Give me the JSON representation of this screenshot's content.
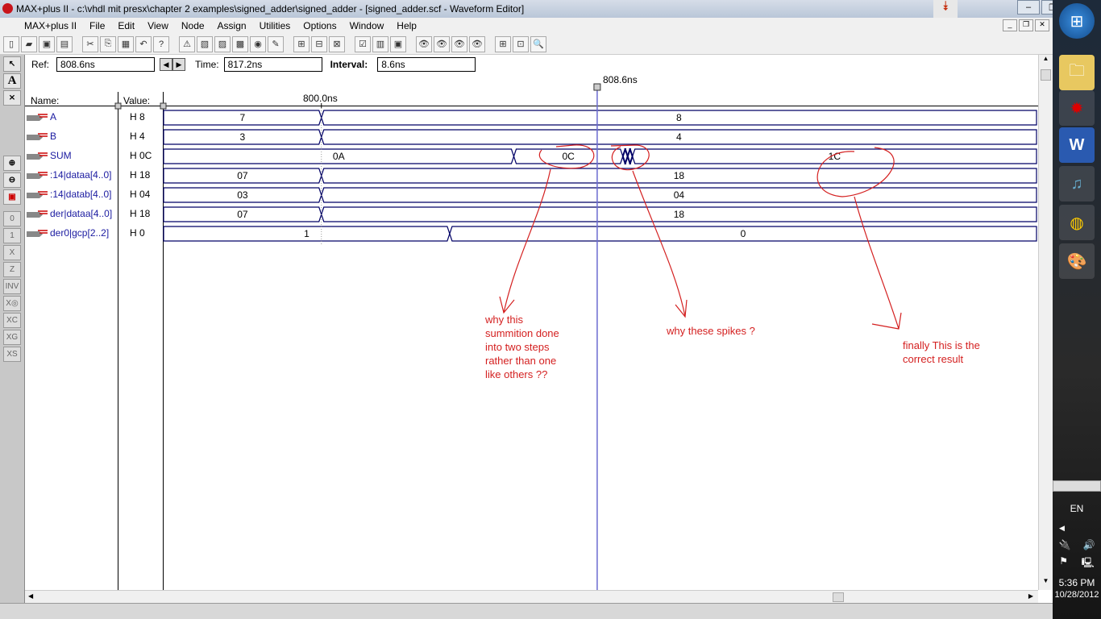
{
  "window": {
    "title": "MAX+plus II - c:\\vhdl mit presx\\chapter 2 examples\\signed_adder\\signed_adder - [signed_adder.scf - Waveform Editor]"
  },
  "menu": [
    "MAX+plus II",
    "File",
    "Edit",
    "View",
    "Node",
    "Assign",
    "Utilities",
    "Options",
    "Window",
    "Help"
  ],
  "refbar": {
    "ref_label": "Ref:",
    "ref_value": "808.6ns",
    "time_label": "Time:",
    "time_value": "817.2ns",
    "interval_label": "Interval:",
    "interval_value": "8.6ns"
  },
  "headers": {
    "name": "Name:",
    "value": "Value:",
    "time_mark": "800.0ns",
    "cursor_label": "808.6ns"
  },
  "timeline": {
    "start_ns": 795.08,
    "end_ns": 822.3,
    "mark_ns": 800.0,
    "cursor_ns": 808.6
  },
  "signals": [
    {
      "name": "A",
      "value": "H 8",
      "type": "input",
      "segments": [
        {
          "t0": 795.08,
          "t1": 800.0,
          "label": "7"
        },
        {
          "t0": 800.0,
          "t1": 822.3,
          "label": "8"
        }
      ]
    },
    {
      "name": "B",
      "value": "H 4",
      "type": "input",
      "segments": [
        {
          "t0": 795.08,
          "t1": 800.0,
          "label": "3"
        },
        {
          "t0": 800.0,
          "t1": 822.3,
          "label": "4"
        }
      ]
    },
    {
      "name": "SUM",
      "value": "H 0C",
      "type": "output",
      "segments": [
        {
          "t0": 795.08,
          "t1": 806.0,
          "label": "0A"
        },
        {
          "t0": 806.0,
          "t1": 809.4,
          "label": "0C"
        },
        {
          "t0": 809.4,
          "t1": 809.55,
          "label": ""
        },
        {
          "t0": 809.55,
          "t1": 809.7,
          "label": ""
        },
        {
          "t0": 809.7,
          "t1": 822.3,
          "label": "1C"
        }
      ]
    },
    {
      "name": ":14|dataa[4..0]",
      "value": "H 18",
      "type": "input",
      "segments": [
        {
          "t0": 795.08,
          "t1": 800.0,
          "label": "07"
        },
        {
          "t0": 800.0,
          "t1": 822.3,
          "label": "18"
        }
      ]
    },
    {
      "name": ":14|datab[4..0]",
      "value": "H 04",
      "type": "input",
      "segments": [
        {
          "t0": 795.08,
          "t1": 800.0,
          "label": "03"
        },
        {
          "t0": 800.0,
          "t1": 822.3,
          "label": "04"
        }
      ]
    },
    {
      "name": "der|dataa[4..0]",
      "value": "H 18",
      "type": "input",
      "segments": [
        {
          "t0": 795.08,
          "t1": 800.0,
          "label": "07"
        },
        {
          "t0": 800.0,
          "t1": 822.3,
          "label": "18"
        }
      ]
    },
    {
      "name": "der0|gcp[2..2]",
      "value": "H 0",
      "type": "buried",
      "segments": [
        {
          "t0": 795.08,
          "t1": 804.0,
          "label": "1"
        },
        {
          "t0": 804.0,
          "t1": 822.3,
          "label": "0"
        }
      ]
    }
  ],
  "annotations": {
    "note1": [
      "why this",
      "summition done",
      "into two steps",
      "rather than one",
      "like others ??"
    ],
    "note2": "why these spikes ?",
    "note3": [
      "finally This is the",
      "correct result"
    ]
  },
  "tray": {
    "lang": "EN",
    "time": "5:36 PM",
    "date": "10/28/2012"
  },
  "colors": {
    "wave": "#000066",
    "cursor": "#6a6ad0",
    "annotation": "#d42020",
    "name": "#1a1aa0"
  }
}
